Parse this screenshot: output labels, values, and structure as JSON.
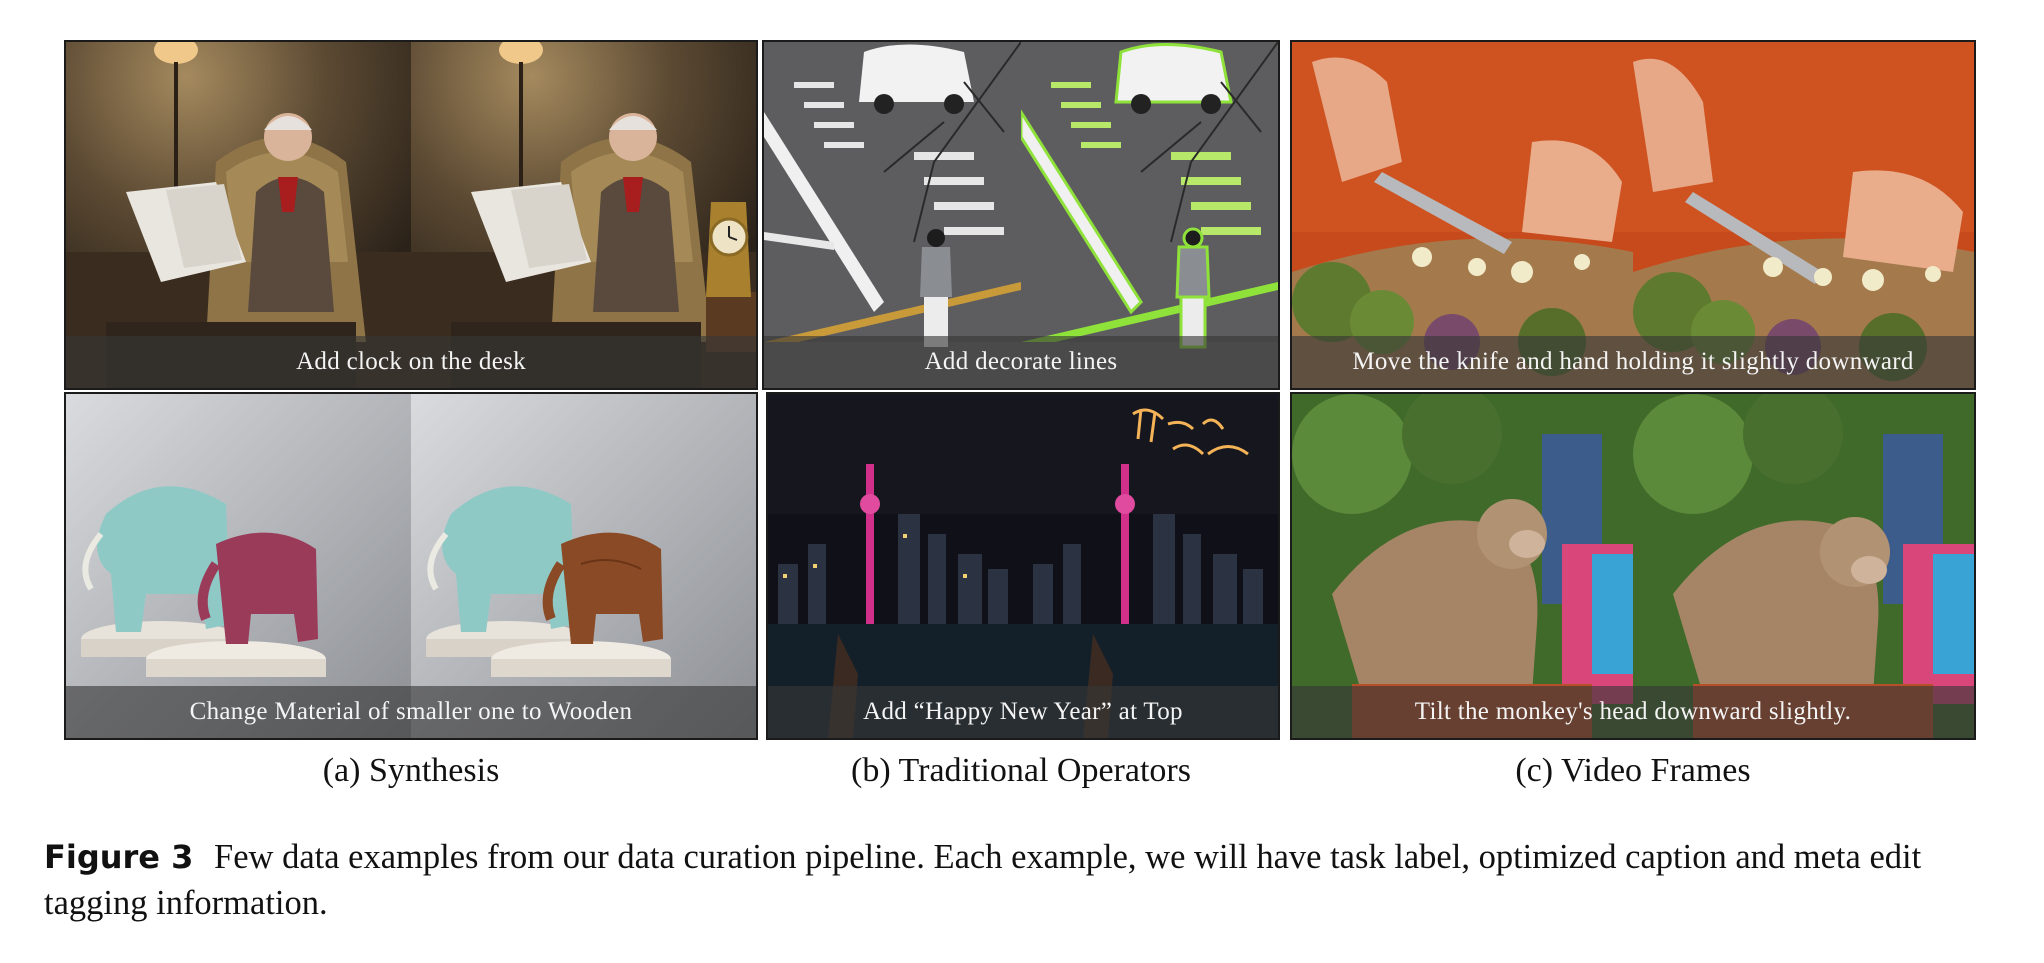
{
  "figure": {
    "number": "Figure 3",
    "caption": "Few data examples from our data curation pipeline. Each example, we will have task label, optimized caption and meta edit tagging information."
  },
  "columns": [
    {
      "label": "(a) Synthesis"
    },
    {
      "label": "(b) Traditional Operators"
    },
    {
      "label": "(c) Video Frames"
    }
  ],
  "examples": [
    {
      "column": "a",
      "row": 1,
      "caption": "Add clock on the desk"
    },
    {
      "column": "b",
      "row": 1,
      "caption": "Add decorate lines"
    },
    {
      "column": "c",
      "row": 1,
      "caption": "Move the knife and hand holding it slightly downward"
    },
    {
      "column": "a",
      "row": 2,
      "caption": "Change Material of smaller one to Wooden"
    },
    {
      "column": "b",
      "row": 2,
      "caption": "Add “Happy New Year” at Top"
    },
    {
      "column": "c",
      "row": 2,
      "caption": "Tilt the monkey's head downward slightly."
    }
  ]
}
